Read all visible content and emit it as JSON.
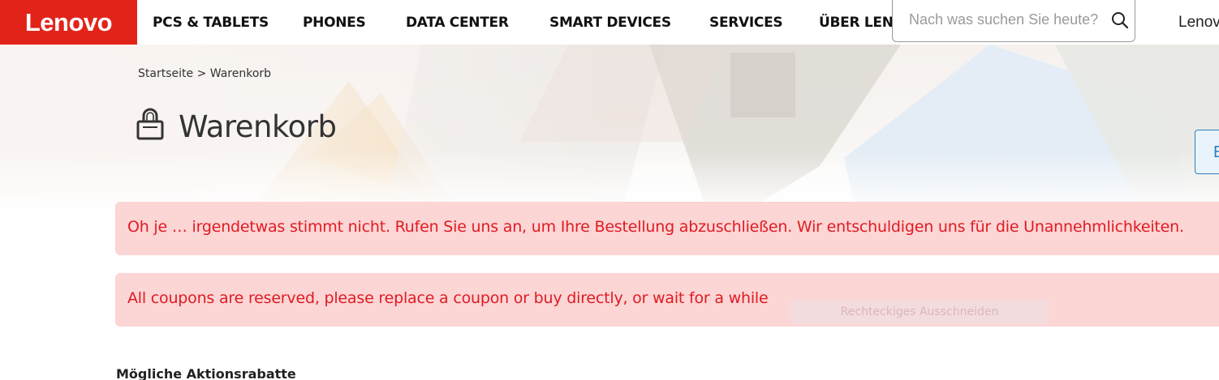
{
  "header": {
    "logo_text": "Lenovo",
    "brand_color": "#e2231a",
    "nav": [
      {
        "label": "PCS & TABLETS"
      },
      {
        "label": "PHONES"
      },
      {
        "label": "DATA CENTER"
      },
      {
        "label": "SMART DEVICES"
      },
      {
        "label": "SERVICES"
      },
      {
        "label": "ÜBER LEN"
      }
    ],
    "search": {
      "placeholder": "Nach was suchen Sie heute?",
      "icon": "search-icon"
    },
    "account_text": "Lenov"
  },
  "breadcrumb": {
    "home": "Startseite",
    "separator": ">",
    "current": "Warenkorb"
  },
  "page": {
    "title": "Warenkorb",
    "title_icon": "lock-icon",
    "side_button_label": "E"
  },
  "alerts": [
    {
      "message": "Oh je … irgendetwas stimmt nicht. Rufen Sie uns an, um Ihre Bestellung abzuschließen. Wir entschuldigen uns für die Unannehmlichkeiten.",
      "color": "#e01b22",
      "background": "#fcd5d5"
    },
    {
      "message": "All coupons are reserved, please replace a coupon or buy directly, or wait for a while",
      "color": "#e01b22",
      "background": "#fcd5d5"
    }
  ],
  "overlay_tooltip": "Rechteckiges Ausschneiden",
  "promotions": {
    "heading": "Mögliche Aktionsrabatte"
  }
}
